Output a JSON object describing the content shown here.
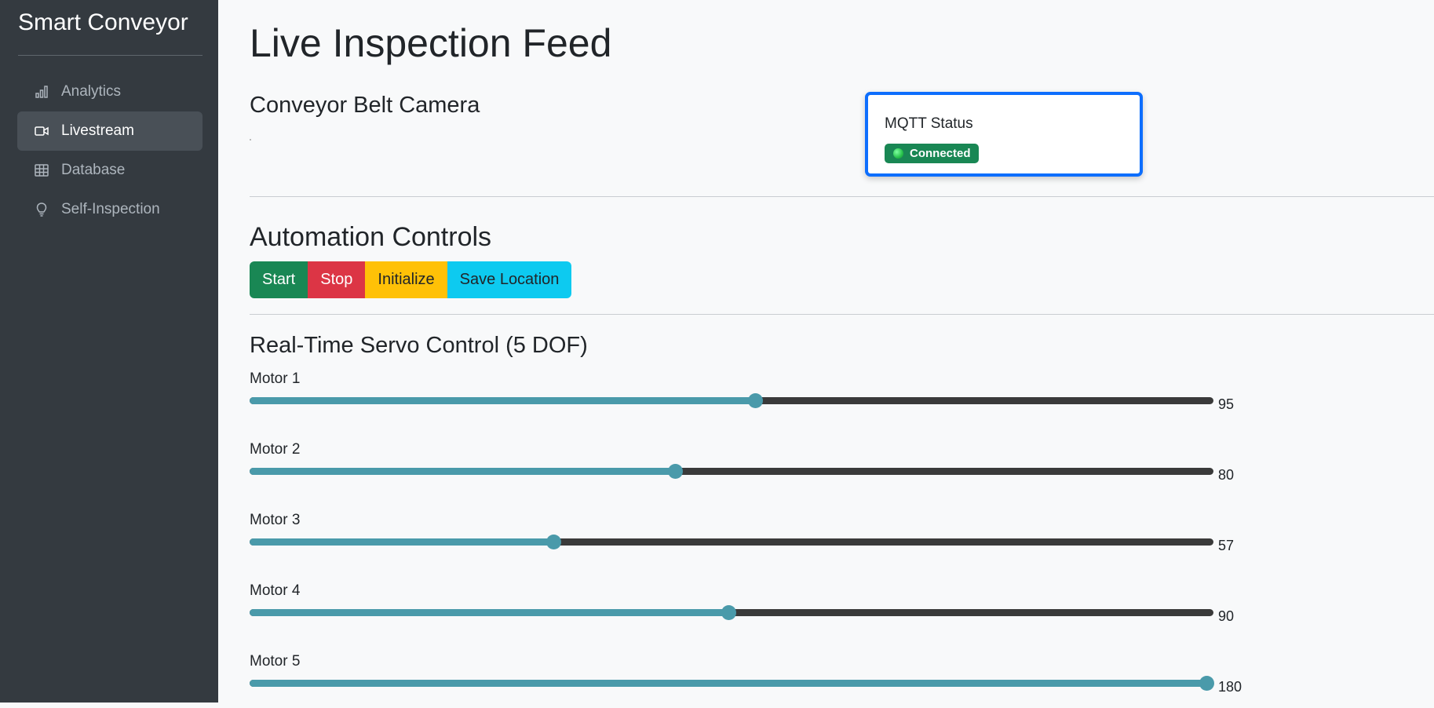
{
  "app": {
    "title": "Smart Conveyor"
  },
  "sidebar": {
    "items": [
      {
        "label": "Analytics",
        "icon": "bar-chart-icon",
        "active": false
      },
      {
        "label": "Livestream",
        "icon": "video-camera-icon",
        "active": true
      },
      {
        "label": "Database",
        "icon": "table-icon",
        "active": false
      },
      {
        "label": "Self-Inspection",
        "icon": "lightbulb-icon",
        "active": false
      }
    ]
  },
  "main": {
    "title": "Live Inspection Feed",
    "camera_title": "Conveyor Belt Camera",
    "mqtt": {
      "title": "MQTT Status",
      "status": "Connected",
      "color": "#198754",
      "card_border": "#0d6efd"
    },
    "automation": {
      "title": "Automation Controls",
      "buttons": [
        {
          "label": "Start",
          "color": "#198754"
        },
        {
          "label": "Stop",
          "color": "#dc3545"
        },
        {
          "label": "Initialize",
          "color": "#ffc107"
        },
        {
          "label": "Save Location",
          "color": "#0dcaf0"
        }
      ]
    },
    "servo": {
      "title": "Real-Time Servo Control (5 DOF)",
      "min": 0,
      "max": 180,
      "motors": [
        {
          "label": "Motor 1",
          "value": 95
        },
        {
          "label": "Motor 2",
          "value": 80
        },
        {
          "label": "Motor 3",
          "value": 57
        },
        {
          "label": "Motor 4",
          "value": 90
        },
        {
          "label": "Motor 5",
          "value": 180
        }
      ]
    }
  }
}
